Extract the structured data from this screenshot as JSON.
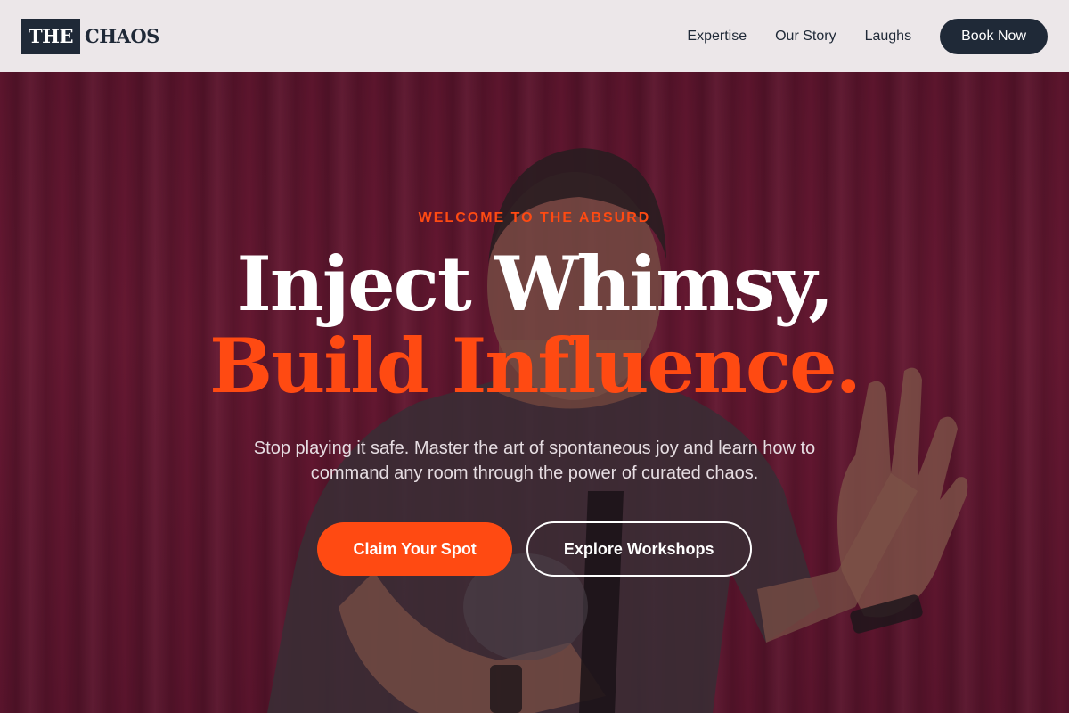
{
  "header": {
    "logo_box": "THE",
    "logo_text": "CHAOS",
    "nav": [
      "Expertise",
      "Our Story",
      "Laughs"
    ],
    "book_label": "Book Now"
  },
  "hero": {
    "eyebrow": "WELCOME TO THE ABSURD",
    "headline_line1": "Inject Whimsy,",
    "headline_line2": "Build Influence.",
    "subtext": "Stop playing it safe. Master the art of spontaneous joy and learn how to command any room through the power of curated chaos.",
    "primary_cta": "Claim Your Spot",
    "secondary_cta": "Explore Workshops"
  },
  "colors": {
    "accent": "#ff4a12",
    "dark": "#1f2937",
    "curtain": "#6d1834",
    "header_bg": "#ece7e9"
  }
}
